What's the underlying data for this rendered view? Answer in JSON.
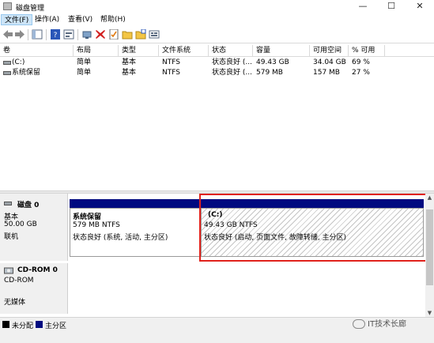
{
  "window": {
    "title": "磁盘管理",
    "controls": {
      "minimize": "—",
      "maximize": "☐",
      "close": "✕"
    }
  },
  "menu": {
    "items": [
      {
        "label": "文件(F)",
        "active": true
      },
      {
        "label": "操作(A)",
        "active": false
      },
      {
        "label": "查看(V)",
        "active": false
      },
      {
        "label": "帮助(H)",
        "active": false
      }
    ]
  },
  "toolbar": {
    "icons": [
      "back-icon",
      "forward-icon",
      "console-tree-icon",
      "help-icon",
      "properties-icon",
      "connect-icon",
      "delete-icon",
      "checklist-icon",
      "open-folder-icon",
      "new-folder-icon",
      "view-icon"
    ]
  },
  "volume_table": {
    "columns": [
      "卷",
      "布局",
      "类型",
      "文件系统",
      "状态",
      "容量",
      "可用空间",
      "% 可用"
    ],
    "rows": [
      [
        "(C:)",
        "简单",
        "基本",
        "NTFS",
        "状态良好 (...",
        "49.43 GB",
        "34.04 GB",
        "69 %"
      ],
      [
        "系统保留",
        "简单",
        "基本",
        "NTFS",
        "状态良好 (...",
        "579 MB",
        "157 MB",
        "27 %"
      ]
    ]
  },
  "disks": [
    {
      "name": "磁盘 0",
      "type": "基本",
      "size": "50.00 GB",
      "status": "联机",
      "partitions": [
        {
          "name": "系统保留",
          "size_fs": "579 MB NTFS",
          "status": "状态良好 (系统, 活动, 主分区)"
        },
        {
          "name": "(C:)",
          "size_fs": "49.43 GB NTFS",
          "status": "状态良好 (启动, 页面文件, 故障转储, 主分区)"
        }
      ]
    },
    {
      "name": "CD-ROM 0",
      "type": "CD-ROM",
      "size": "",
      "status": "无媒体"
    }
  ],
  "legend": [
    {
      "label": "未分配",
      "color": "#000000"
    },
    {
      "label": "主分区",
      "color": "#000a80"
    }
  ],
  "watermark": "IT技术长廊",
  "colors": {
    "primary_partition": "#000a80",
    "highlight": "#e0221c",
    "menu_active": "#cce4f7"
  }
}
